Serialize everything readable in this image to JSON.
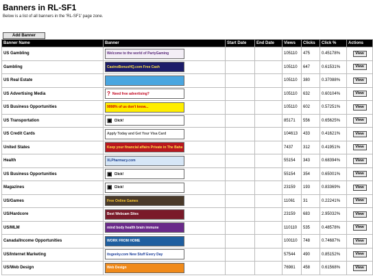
{
  "page": {
    "title": "Banners in RL-SF1",
    "subtitle": "Below is a list of all banners in the 'RL-SF1' page zone.",
    "add_button": "Add Banner"
  },
  "table": {
    "headers": [
      "Banner Name",
      "Banner",
      "Start Date",
      "End Date",
      "Views",
      "Clicks",
      "Click %",
      "Actions"
    ],
    "view_label": "View",
    "rows": [
      {
        "name": "US Gambling",
        "banner_text": "Welcome to the world of PartyGaming",
        "banner_icon": "",
        "banner_bg": "#f3eef6",
        "banner_fg": "#5a2a7a",
        "views": "105110",
        "clicks": "475",
        "click_pct": "0.45178%"
      },
      {
        "name": "Gambling",
        "banner_text": "CasinoBonusHQ.com  Free Cash",
        "banner_icon": "",
        "banner_bg": "#1c1c6a",
        "banner_fg": "#ffe34d",
        "views": "105110",
        "clicks": "647",
        "click_pct": "0.61531%"
      },
      {
        "name": "US Real Estate",
        "banner_text": "",
        "banner_icon": "",
        "banner_bg": "#4aa6e0",
        "banner_fg": "#ffffff",
        "views": "105110",
        "clicks": "380",
        "click_pct": "0.37088%"
      },
      {
        "name": "US Advertising Media",
        "banner_text": "Need free advertising?",
        "banner_icon": "?",
        "banner_bg": "#ffffff",
        "banner_fg": "#c0001a",
        "views": "105110",
        "clicks": "632",
        "click_pct": "0.60104%"
      },
      {
        "name": "US Business Opportunities",
        "banner_text": "9998% of us don't know...",
        "banner_icon": "",
        "banner_bg": "#ffee00",
        "banner_fg": "#cc0000",
        "views": "105110",
        "clicks": "602",
        "click_pct": "0.57251%"
      },
      {
        "name": "US Transportation",
        "banner_text": "Click!",
        "banner_icon": "▣",
        "banner_bg": "#ffffff",
        "banner_fg": "#000000",
        "views": "85171",
        "clicks": "556",
        "click_pct": "0.65625%"
      },
      {
        "name": "US Credit Cards",
        "banner_text": "Apply Today and Get Your Visa Card",
        "banner_icon": "",
        "banner_bg": "#ffffff",
        "banner_fg": "#444444",
        "views": "104613",
        "clicks": "433",
        "click_pct": "0.41621%"
      },
      {
        "name": "United States",
        "banner_text": "Keep your financial affairs Private in The Bahamas",
        "banner_icon": "",
        "banner_bg": "#b8171f",
        "banner_fg": "#ffe04a",
        "views": "7437",
        "clicks": "312",
        "click_pct": "0.41951%"
      },
      {
        "name": "Health",
        "banner_text": "XLPharmacy.com",
        "banner_icon": "",
        "banner_bg": "#d6e6f6",
        "banner_fg": "#1b3f8f",
        "views": "55154",
        "clicks": "343",
        "click_pct": "0.68394%"
      },
      {
        "name": "US Business Opportunities",
        "banner_text": "Click!",
        "banner_icon": "▣",
        "banner_bg": "#ffffff",
        "banner_fg": "#000000",
        "views": "55154",
        "clicks": "354",
        "click_pct": "0.65001%"
      },
      {
        "name": "Magazines",
        "banner_text": "Click!",
        "banner_icon": "▣",
        "banner_bg": "#ffffff",
        "banner_fg": "#000000",
        "views": "23159",
        "clicks": "193",
        "click_pct": "0.83369%"
      },
      {
        "name": "US/Games",
        "banner_text": "Free Online Games",
        "banner_icon": "",
        "banner_bg": "#4a3a2a",
        "banner_fg": "#ffcc33",
        "views": "11061",
        "clicks": "31",
        "click_pct": "0.22241%"
      },
      {
        "name": "US/Hardcore",
        "banner_text": "Best Webcam Sites",
        "banner_icon": "",
        "banner_bg": "#7a1a2a",
        "banner_fg": "#ffffff",
        "views": "23159",
        "clicks": "683",
        "click_pct": "2.95032%"
      },
      {
        "name": "US/MLM",
        "banner_text": "mind  body  health  brain  immune",
        "banner_icon": "",
        "banner_bg": "#6a2a8a",
        "banner_fg": "#ffffff",
        "views": "110110",
        "clicks": "535",
        "click_pct": "0.48578%"
      },
      {
        "name": "Canada/Income Opportunities",
        "banner_text": "WORK FROM HOME",
        "banner_icon": "",
        "banner_bg": "#1f5fa0",
        "banner_fg": "#ffffff",
        "views": "100110",
        "clicks": "748",
        "click_pct": "0.74687%"
      },
      {
        "name": "US/Internet Marketing",
        "banner_text": "itsgeeky.com  New Stuff Every Day",
        "banner_icon": "",
        "banner_bg": "#ffffff",
        "banner_fg": "#1a3d9a",
        "views": "57544",
        "clicks": "490",
        "click_pct": "0.85152%"
      },
      {
        "name": "US/Web Design",
        "banner_text": "Web Design",
        "banner_icon": "",
        "banner_bg": "#f08a1a",
        "banner_fg": "#ffffff",
        "views": "76981",
        "clicks": "458",
        "click_pct": "0.61568%"
      }
    ]
  }
}
